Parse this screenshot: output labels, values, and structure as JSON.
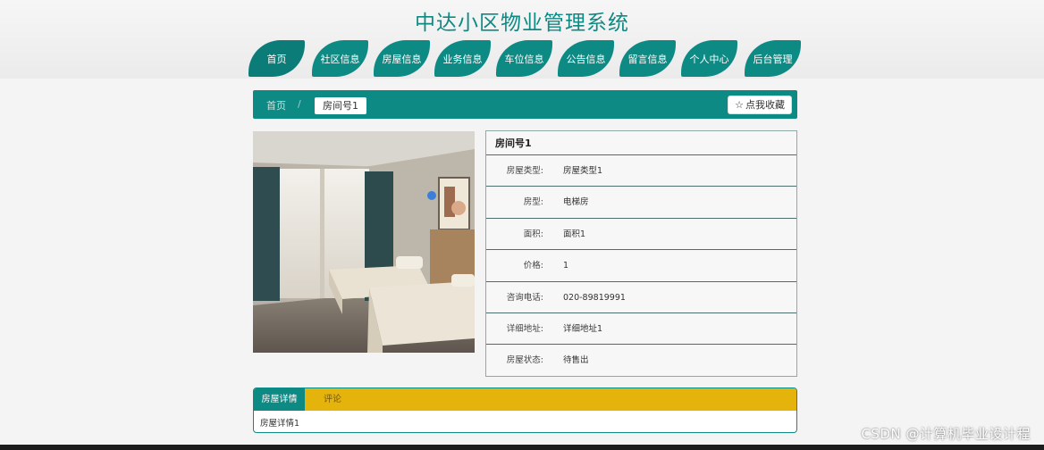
{
  "site": {
    "title": "中达小区物业管理系统"
  },
  "nav": [
    {
      "label": "首页",
      "active": true
    },
    {
      "label": "社区信息"
    },
    {
      "label": "房屋信息"
    },
    {
      "label": "业务信息"
    },
    {
      "label": "车位信息"
    },
    {
      "label": "公告信息"
    },
    {
      "label": "留言信息"
    },
    {
      "label": "个人中心"
    },
    {
      "label": "后台管理"
    }
  ],
  "breadcrumb": {
    "home": "首页",
    "separator": "/",
    "current": "房间号1"
  },
  "favorite": {
    "icon": "star-icon",
    "label": "点我收藏"
  },
  "detail": {
    "title": "房间号1",
    "rows": [
      {
        "label": "房屋类型:",
        "value": "房屋类型1"
      },
      {
        "label": "房型:",
        "value": "电梯房"
      },
      {
        "label": "面积:",
        "value": "面积1"
      },
      {
        "label": "价格:",
        "value": "1"
      },
      {
        "label": "咨询电话:",
        "value": "020-89819991"
      },
      {
        "label": "详细地址:",
        "value": "详细地址1"
      },
      {
        "label": "房屋状态:",
        "value": "待售出"
      }
    ]
  },
  "tabs": {
    "active": "房屋详情",
    "inactive": "评论",
    "content": "房屋详情1"
  },
  "watermark": "CSDN @计算机毕业设计程",
  "colors": {
    "primary": "#0e8a84",
    "tab_strip": "#e4b30c"
  }
}
